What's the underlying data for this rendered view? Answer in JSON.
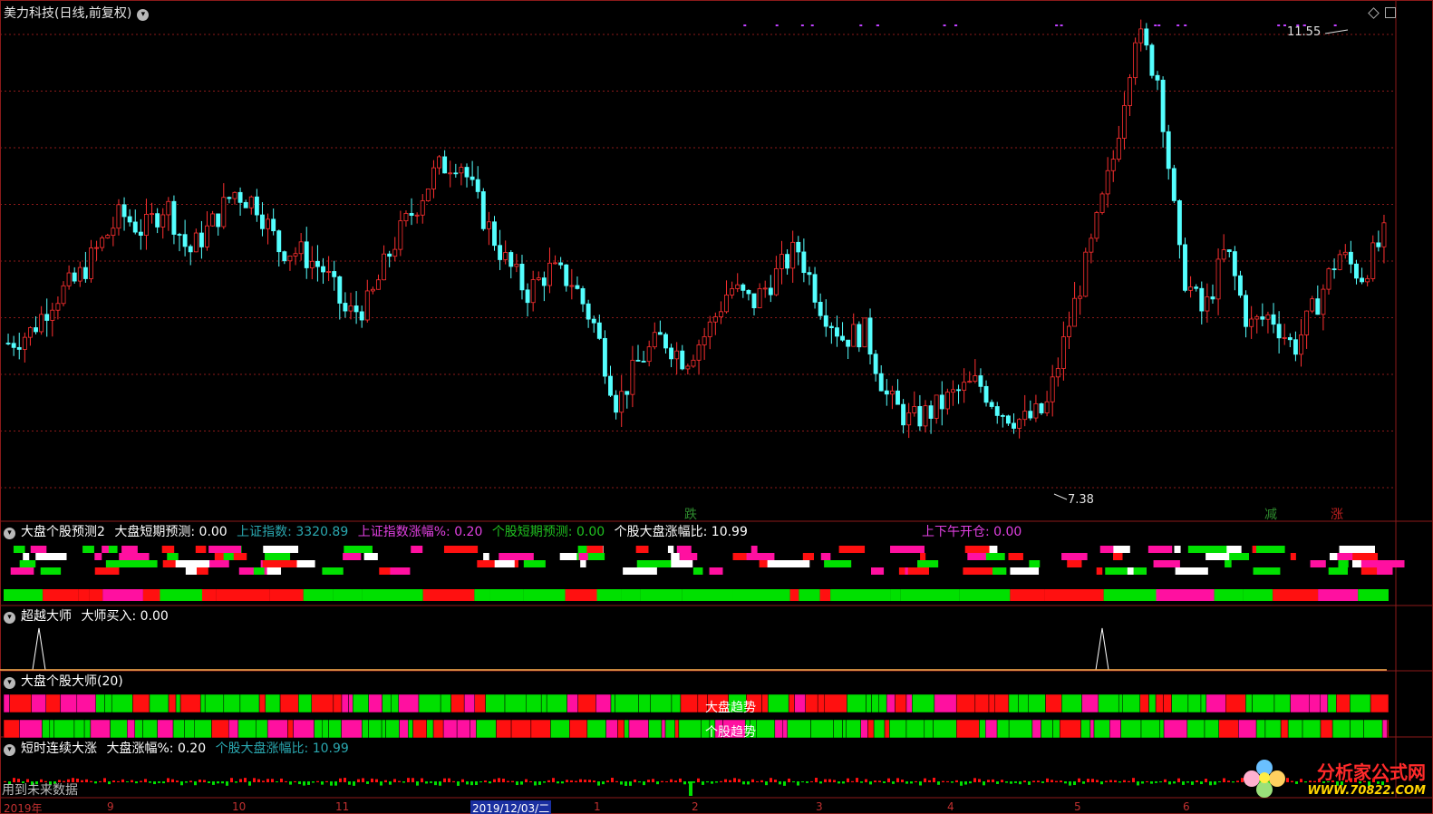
{
  "window": {
    "title": "美力科技(日线,前复权)",
    "icon": "chevron-down-icon"
  },
  "main_chart": {
    "high_label": "11.55",
    "low_label": "7.38",
    "markers": [
      {
        "text": "跌",
        "color": "#2e8b2e"
      },
      {
        "text": "减",
        "color": "#2e8b2e"
      },
      {
        "text": "涨",
        "color": "#c02020"
      }
    ]
  },
  "panel1": {
    "title": "大盘个股预测2",
    "items": [
      {
        "label": "大盘短期预测:",
        "value": "0.00",
        "color": "#ffffff"
      },
      {
        "label": "上证指数:",
        "value": "3320.89",
        "color": "#2aa8b0"
      },
      {
        "label": "上证指数涨幅%:",
        "value": "0.20",
        "color": "#e040e0"
      },
      {
        "label": "个股短期预测:",
        "value": "0.00",
        "color": "#20c020"
      },
      {
        "label": "个股大盘涨幅比:",
        "value": "10.99",
        "color": "#ffffff"
      }
    ],
    "right_item": {
      "label": "上下午开仓:",
      "value": "0.00",
      "color": "#e040e0"
    }
  },
  "panel2": {
    "title": "超越大师",
    "items": [
      {
        "label": "大师买入:",
        "value": "0.00",
        "color": "#ffffff"
      }
    ]
  },
  "panel3": {
    "title": "大盘个股大师(20)",
    "row1_label": "大盘趋势",
    "row2_label": "个股趋势"
  },
  "panel4": {
    "title": "短时连续大涨",
    "items": [
      {
        "label": "大盘涨幅%:",
        "value": "0.20",
        "color": "#ffffff"
      },
      {
        "label": "个股大盘涨幅比:",
        "value": "10.99",
        "color": "#2aa8b0"
      }
    ],
    "note": "用到未来数据"
  },
  "date_axis": [
    "2019年",
    "9",
    "10",
    "11",
    "2019/12/03/二",
    "1",
    "2",
    "3",
    "4",
    "5",
    "6"
  ],
  "watermark": {
    "name": "分析家公式网",
    "url": "WWW.70822.COM"
  },
  "colors": {
    "up": "#ff3030",
    "down": "#54ffff",
    "grid": "#8b1a1a",
    "green": "#00e000",
    "magenta": "#ff10a0",
    "red": "#ff1010"
  },
  "chart_data": {
    "type": "line",
    "series": [
      {
        "values": [
          8.75,
          8.85,
          9.15,
          9.3,
          9.6,
          9.9,
          9.75,
          10.0,
          9.55,
          9.8,
          10.1,
          10.0,
          9.6,
          9.55,
          9.4,
          9.0,
          9.1,
          9.6,
          9.95,
          10.3,
          10.4,
          9.9,
          9.5,
          9.2,
          9.4,
          9.3,
          8.9,
          8.2,
          8.6,
          8.8,
          8.6,
          8.85,
          9.25,
          9.1,
          9.35,
          9.6,
          9.1,
          8.8,
          8.85,
          8.25,
          8.05,
          8.15,
          8.3,
          8.4,
          8.15,
          8.05,
          8.15,
          8.9,
          9.6,
          10.4,
          11.55,
          11.1,
          9.4,
          9.0,
          9.6,
          8.9,
          9.0,
          8.7,
          9.1,
          9.55,
          9.35,
          9.7
        ],
        "x": [
          0,
          4,
          8,
          12,
          16,
          20,
          24,
          28,
          32,
          36,
          40,
          44,
          48,
          52,
          56,
          60,
          64,
          68,
          72,
          76,
          80,
          84,
          88,
          92,
          96,
          100,
          104,
          108,
          112,
          116,
          120,
          124,
          128,
          132,
          136,
          140,
          144,
          148,
          152,
          156,
          160,
          164,
          168,
          172,
          176,
          180,
          184,
          188,
          192,
          196,
          200,
          204,
          208,
          212,
          216,
          220,
          224,
          228,
          232,
          236,
          240,
          244
        ]
      }
    ]
  }
}
